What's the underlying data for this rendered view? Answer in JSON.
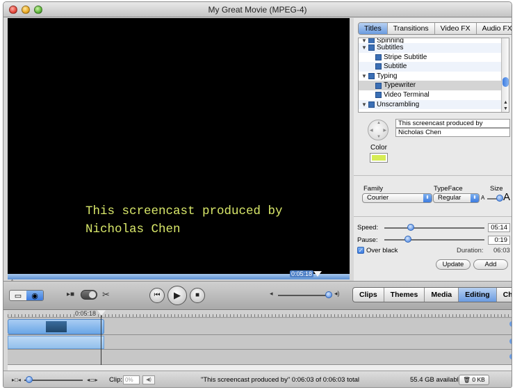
{
  "window": {
    "title": "My Great Movie (MPEG-4)"
  },
  "viewer": {
    "title_line1": "This screencast produced by",
    "title_line2": "Nicholas Chen",
    "playhead_time": "0:05:18"
  },
  "effects_tabs": [
    {
      "label": "Titles",
      "active": true
    },
    {
      "label": "Transitions",
      "active": false
    },
    {
      "label": "Video FX",
      "active": false
    },
    {
      "label": "Audio FX",
      "active": false
    }
  ],
  "effects_list": [
    {
      "label": "Spinning",
      "group": true,
      "partial": true
    },
    {
      "label": "Subtitles",
      "group": true
    },
    {
      "label": "Stripe Subtitle",
      "group": false
    },
    {
      "label": "Subtitle",
      "group": false
    },
    {
      "label": "Typing",
      "group": true
    },
    {
      "label": "Typewriter",
      "group": false,
      "selected": true
    },
    {
      "label": "Video Terminal",
      "group": false
    },
    {
      "label": "Unscrambling",
      "group": true
    }
  ],
  "text_fields": {
    "line1": "This screencast produced by",
    "line2": "Nicholas Chen"
  },
  "color": {
    "label": "Color",
    "value": "#d6ec55"
  },
  "font": {
    "family_label": "Family",
    "family_value": "Courier",
    "typeface_label": "TypeFace",
    "typeface_value": "Regular",
    "size_label": "Size",
    "size_small": "A",
    "size_big": "A"
  },
  "timing": {
    "speed_label": "Speed:",
    "speed_value": "05:14",
    "pause_label": "Pause:",
    "pause_value": "0:19",
    "over_black_label": "Over black",
    "over_black_checked": true,
    "duration_label": "Duration:",
    "duration_value": "06:03"
  },
  "actions": {
    "update": "Update",
    "add": "Add"
  },
  "panel_tabs": [
    {
      "label": "Clips",
      "active": false
    },
    {
      "label": "Themes",
      "active": false
    },
    {
      "label": "Media",
      "active": false
    },
    {
      "label": "Editing",
      "active": true
    },
    {
      "label": "Chapters",
      "active": false
    }
  ],
  "timeline": {
    "playhead_time": "0:05:18"
  },
  "status": {
    "clip_label": "Clip:",
    "clip_placeholder": "0%",
    "message": "\"This screencast produced by\"  0:06:03 of 0:06:03 total",
    "available": "55.4 GB available",
    "trash": "0 KB"
  }
}
